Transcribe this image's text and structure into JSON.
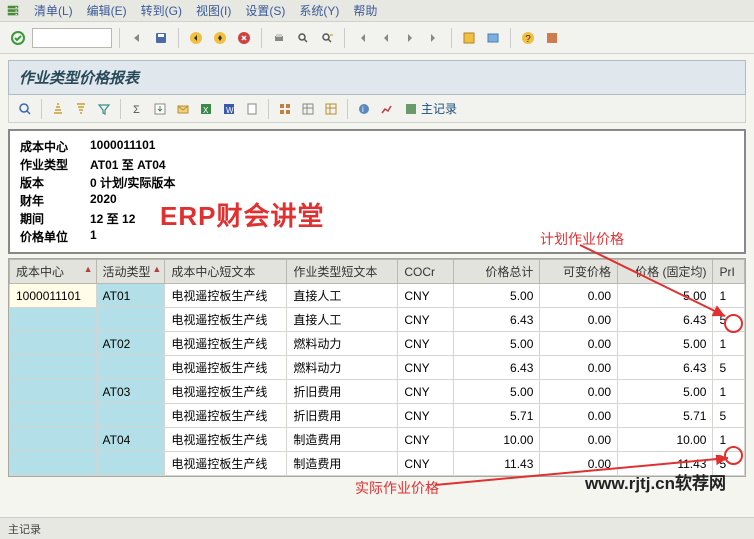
{
  "menu": {
    "items": [
      "清单(L)",
      "编辑(E)",
      "转到(G)",
      "视图(I)",
      "设置(S)",
      "系统(Y)",
      "帮助"
    ]
  },
  "title": "作业类型价格报表",
  "toolbar2_link": "主记录",
  "info": {
    "cost_center_label": "成本中心",
    "cost_center_value": "1000011101",
    "activity_label": "作业类型",
    "activity_value": "AT01 至 AT04",
    "version_label": "版本",
    "version_value": "0 计划/实际版本",
    "year_label": "财年",
    "year_value": "2020",
    "period_label": "期间",
    "period_value": "12 至 12",
    "unit_label": "价格单位",
    "unit_value": "1"
  },
  "overlay": {
    "brand": "ERP财会讲堂",
    "anno1": "计划作业价格",
    "anno2": "实际作业价格",
    "watermark": "www.rjtj.cn软荐网"
  },
  "columns": [
    "成本中心",
    "活动类型",
    "成本中心短文本",
    "作业类型短文本",
    "COCr",
    "价格总计",
    "可变价格",
    "价格 (固定均)",
    "PrI"
  ],
  "rows": [
    {
      "cc": "1000011101",
      "at": "AT01",
      "cctxt": "电视遥控板生产线",
      "attxt": "直接人工",
      "cocr": "CNY",
      "total": "5.00",
      "var": "0.00",
      "fix": "5.00",
      "pri": "1"
    },
    {
      "cc": "",
      "at": "",
      "cctxt": "电视遥控板生产线",
      "attxt": "直接人工",
      "cocr": "CNY",
      "total": "6.43",
      "var": "0.00",
      "fix": "6.43",
      "pri": "5"
    },
    {
      "cc": "",
      "at": "AT02",
      "cctxt": "电视遥控板生产线",
      "attxt": "燃料动力",
      "cocr": "CNY",
      "total": "5.00",
      "var": "0.00",
      "fix": "5.00",
      "pri": "1"
    },
    {
      "cc": "",
      "at": "",
      "cctxt": "电视遥控板生产线",
      "attxt": "燃料动力",
      "cocr": "CNY",
      "total": "6.43",
      "var": "0.00",
      "fix": "6.43",
      "pri": "5"
    },
    {
      "cc": "",
      "at": "AT03",
      "cctxt": "电视遥控板生产线",
      "attxt": "折旧费用",
      "cocr": "CNY",
      "total": "5.00",
      "var": "0.00",
      "fix": "5.00",
      "pri": "1"
    },
    {
      "cc": "",
      "at": "",
      "cctxt": "电视遥控板生产线",
      "attxt": "折旧费用",
      "cocr": "CNY",
      "total": "5.71",
      "var": "0.00",
      "fix": "5.71",
      "pri": "5"
    },
    {
      "cc": "",
      "at": "AT04",
      "cctxt": "电视遥控板生产线",
      "attxt": "制造费用",
      "cocr": "CNY",
      "total": "10.00",
      "var": "0.00",
      "fix": "10.00",
      "pri": "1"
    },
    {
      "cc": "",
      "at": "",
      "cctxt": "电视遥控板生产线",
      "attxt": "制造费用",
      "cocr": "CNY",
      "total": "11.43",
      "var": "0.00",
      "fix": "11.43",
      "pri": "5"
    }
  ],
  "status": "主记录"
}
